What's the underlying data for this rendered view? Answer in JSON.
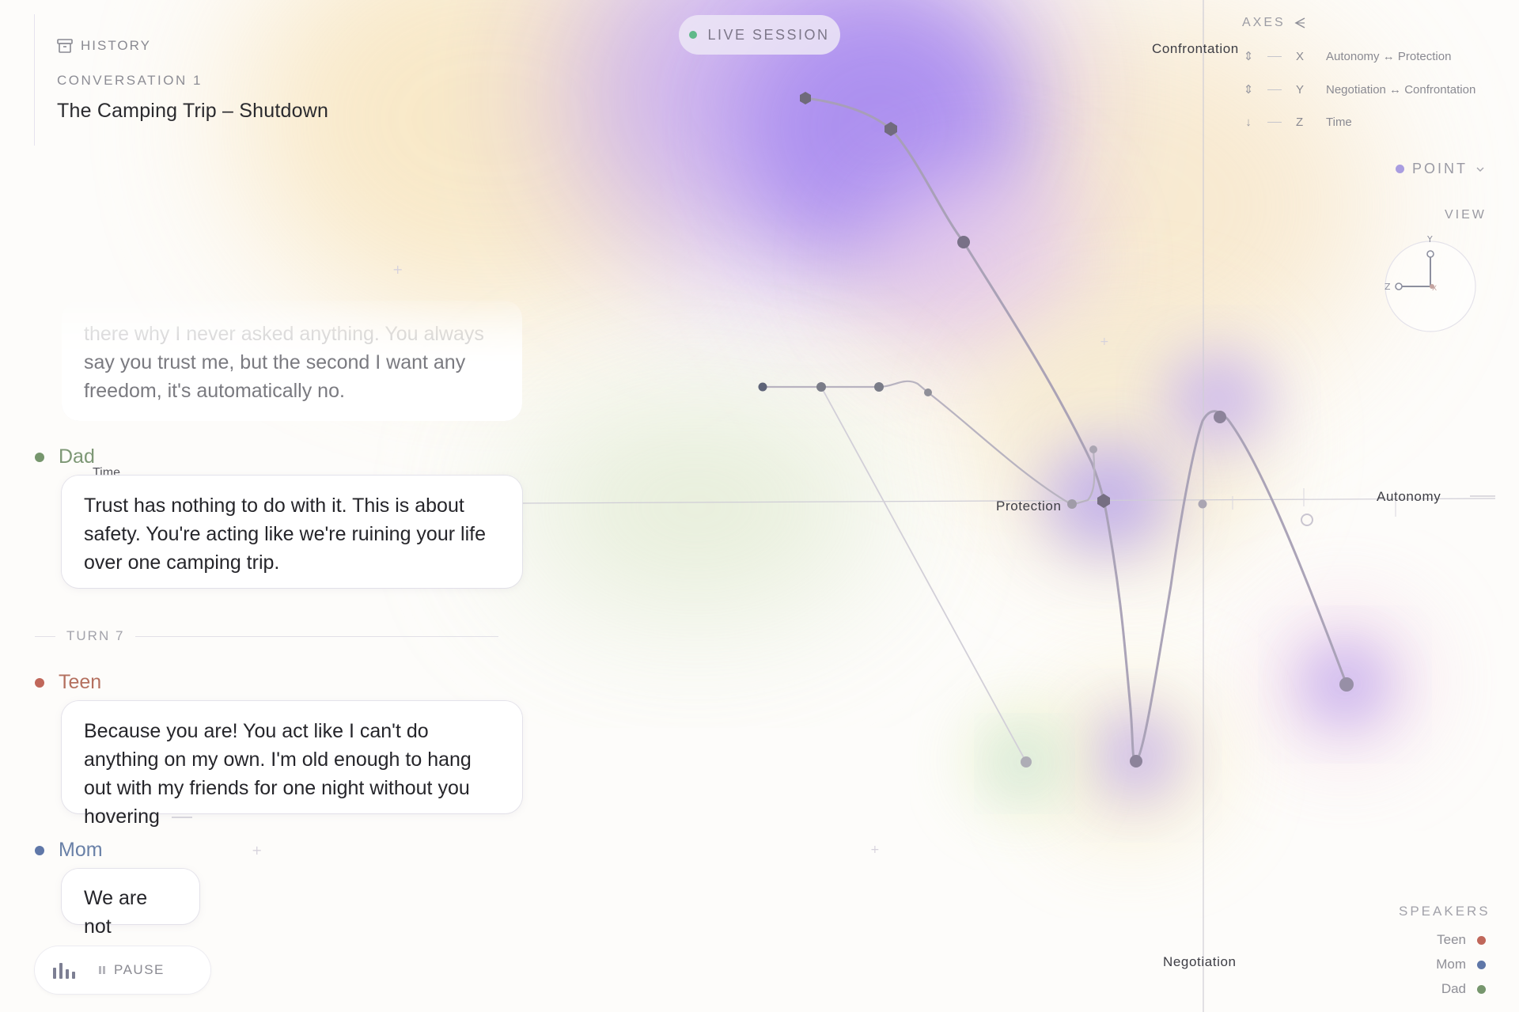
{
  "history": {
    "icon": "archive-icon",
    "label": "HISTORY",
    "conversation_label": "CONVERSATION 1",
    "conversation_title": "The Camping Trip – Shutdown"
  },
  "session": {
    "label": "LIVE SESSION",
    "status_color": "#5fb98a"
  },
  "chat": {
    "faded_message": "Teen: There why I never asked anything. You always say you trust me, but the second I want any freedom, it's automatically no.",
    "faded_lines": [
      "there why I never asked anything. You always",
      "say you trust me, but the second I want any",
      "freedom, it's automatically no."
    ],
    "dad_name": "Dad",
    "dad_time_label": "Time",
    "dad_message": "Trust has nothing to do with it. This is about safety. You're acting like we're ruining your life over one camping trip.",
    "turn_label": "TURN 7",
    "teen_name": "Teen",
    "teen_message": "Because you are! You act like I can't do anything on my own. I'm old enough to hang out with my friends for one night without you hovering",
    "mom_name": "Mom",
    "mom_message": "We are not"
  },
  "player": {
    "pause_label": "PAUSE"
  },
  "axes": {
    "title": "AXES",
    "rows": [
      {
        "arrow": "⇕",
        "key": "X",
        "desc": "Autonomy ↔ Protection"
      },
      {
        "arrow": "⇕",
        "key": "Y",
        "desc": "Negotiation ↔ Confrontation"
      },
      {
        "arrow": "↓",
        "key": "Z",
        "desc": "Time"
      }
    ]
  },
  "mode": {
    "label": "POINT",
    "dot_color": "#a99de0"
  },
  "view": {
    "label": "VIEW",
    "gizmo_y": "Y",
    "gizmo_z": "Z",
    "gizmo_x": "X"
  },
  "plot_labels": {
    "confrontation": "Confrontation",
    "autonomy": "Autonomy",
    "protection": "Protection",
    "negotiation": "Negotiation"
  },
  "speakers": {
    "title": "SPEAKERS",
    "items": [
      {
        "name": "Teen",
        "color": "#c0675a"
      },
      {
        "name": "Mom",
        "color": "#5f77a8"
      },
      {
        "name": "Dad",
        "color": "#76966d"
      }
    ]
  }
}
